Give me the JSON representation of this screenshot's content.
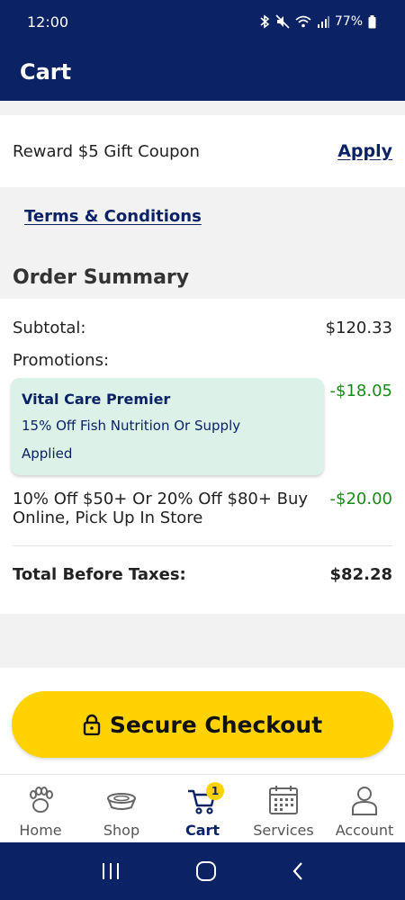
{
  "status_bar": {
    "time": "12:00",
    "battery": "77%",
    "icons": [
      "bluetooth-icon",
      "mute-icon",
      "wifi-icon",
      "signal-icon",
      "battery-icon"
    ]
  },
  "header": {
    "title": "Cart"
  },
  "reward": {
    "text": "Reward $5 Gift Coupon",
    "apply_label": "Apply"
  },
  "terms": {
    "label": "Terms & Conditions"
  },
  "order_summary": {
    "title": "Order Summary",
    "subtotal_label": "Subtotal:",
    "subtotal_value": "$120.33",
    "promotions_label": "Promotions:",
    "promo1": {
      "name": "Vital Care Premier",
      "description": "15% Off Fish Nutrition Or Supply",
      "status": "Applied",
      "amount": "-$18.05"
    },
    "promo2": {
      "description": "10% Off $50+ Or 20% Off $80+ Buy Online, Pick Up In Store",
      "amount": "-$20.00"
    },
    "total_label": "Total Before Taxes:",
    "total_value": "$82.28"
  },
  "checkout": {
    "label": "Secure Checkout",
    "icon": "lock-icon"
  },
  "tabs": [
    {
      "label": "Home",
      "icon": "paw-icon"
    },
    {
      "label": "Shop",
      "icon": "bowl-icon"
    },
    {
      "label": "Cart",
      "icon": "cart-icon",
      "badge": "1",
      "active": true
    },
    {
      "label": "Services",
      "icon": "calendar-icon"
    },
    {
      "label": "Account",
      "icon": "person-icon"
    }
  ],
  "colors": {
    "brand": "#0b2265",
    "accent": "#ffd200",
    "discount": "#1a8a1a",
    "promo_bg": "#dcf1e7"
  }
}
